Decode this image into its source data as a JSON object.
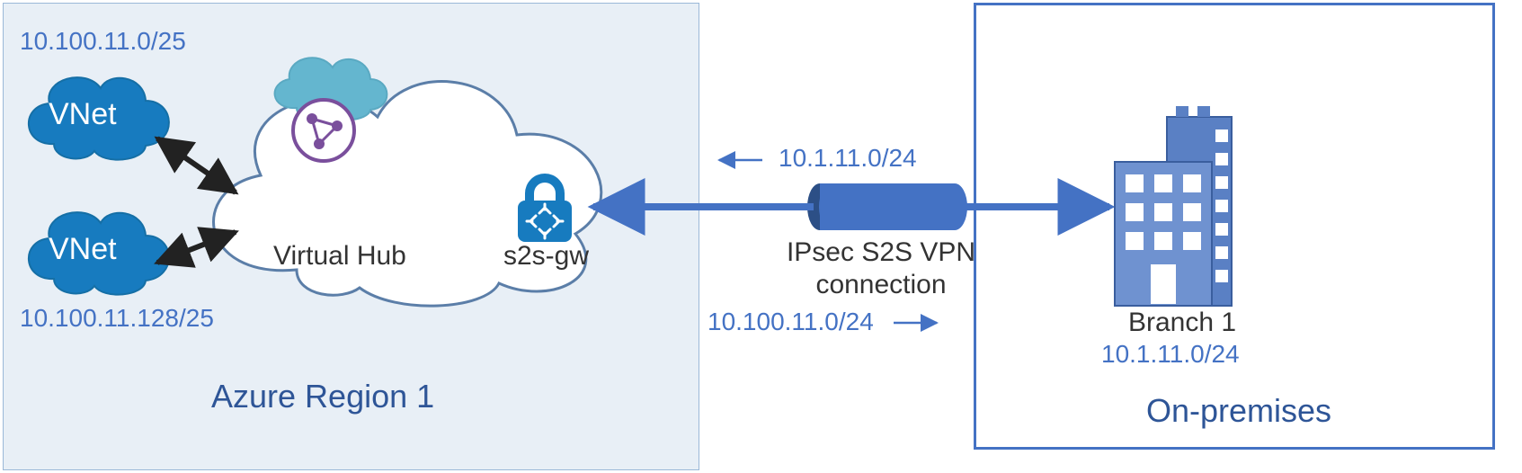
{
  "azure": {
    "title": "Azure Region 1",
    "vnet1_cidr": "10.100.11.0/25",
    "vnet2_cidr": "10.100.11.128/25",
    "vnet_label": "VNet",
    "hub_label": "Virtual Hub",
    "gw_label": "s2s-gw"
  },
  "tunnel": {
    "label_line1": "IPsec S2S VPN",
    "label_line2": "connection",
    "inbound_cidr": "10.1.11.0/24",
    "outbound_cidr": "10.100.11.0/24"
  },
  "onprem": {
    "title": "On-premises",
    "branch_label": "Branch 1",
    "branch_cidr": "10.1.11.0/24"
  }
}
